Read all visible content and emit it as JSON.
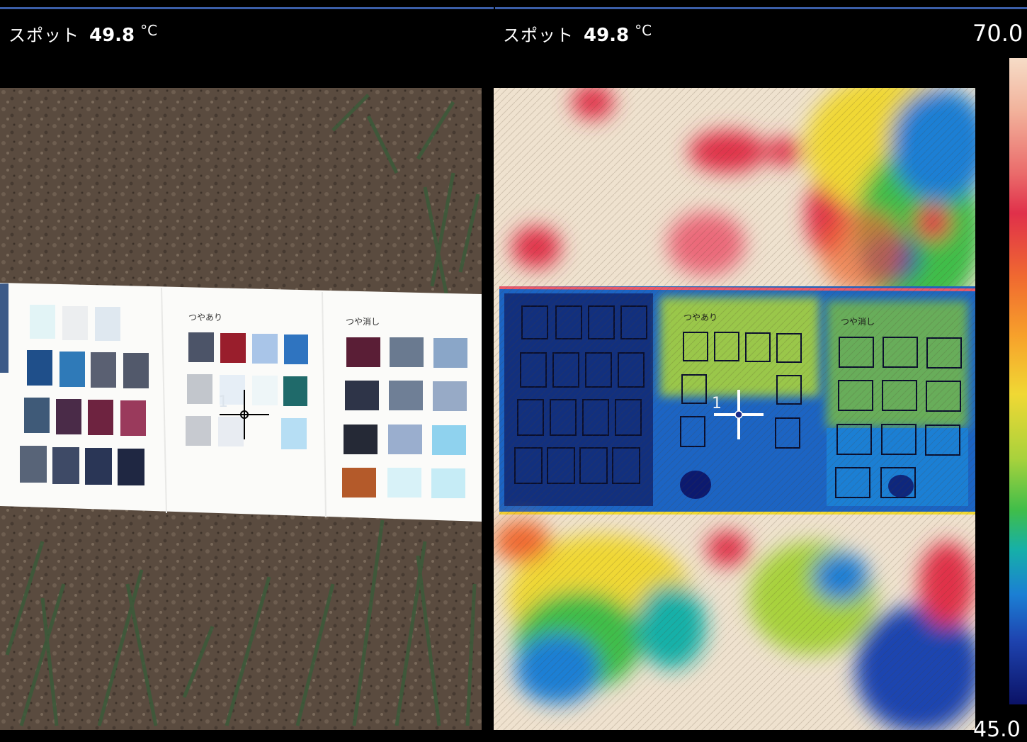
{
  "left_readout": {
    "label": "スポット",
    "value": "49.8",
    "unit": "°C"
  },
  "right_readout": {
    "label": "スポット",
    "value": "49.8",
    "unit": "°C"
  },
  "scale": {
    "max": "70.0",
    "min": "45.0"
  },
  "spot_marker": {
    "number": "1"
  },
  "chart_left": {
    "section_glossy": "つやあり",
    "section_matte": "つや消し"
  },
  "colors": {
    "accent": "#3b5ea8",
    "crosshair_visible": "#000000",
    "crosshair_thermal": "#ffffff"
  }
}
